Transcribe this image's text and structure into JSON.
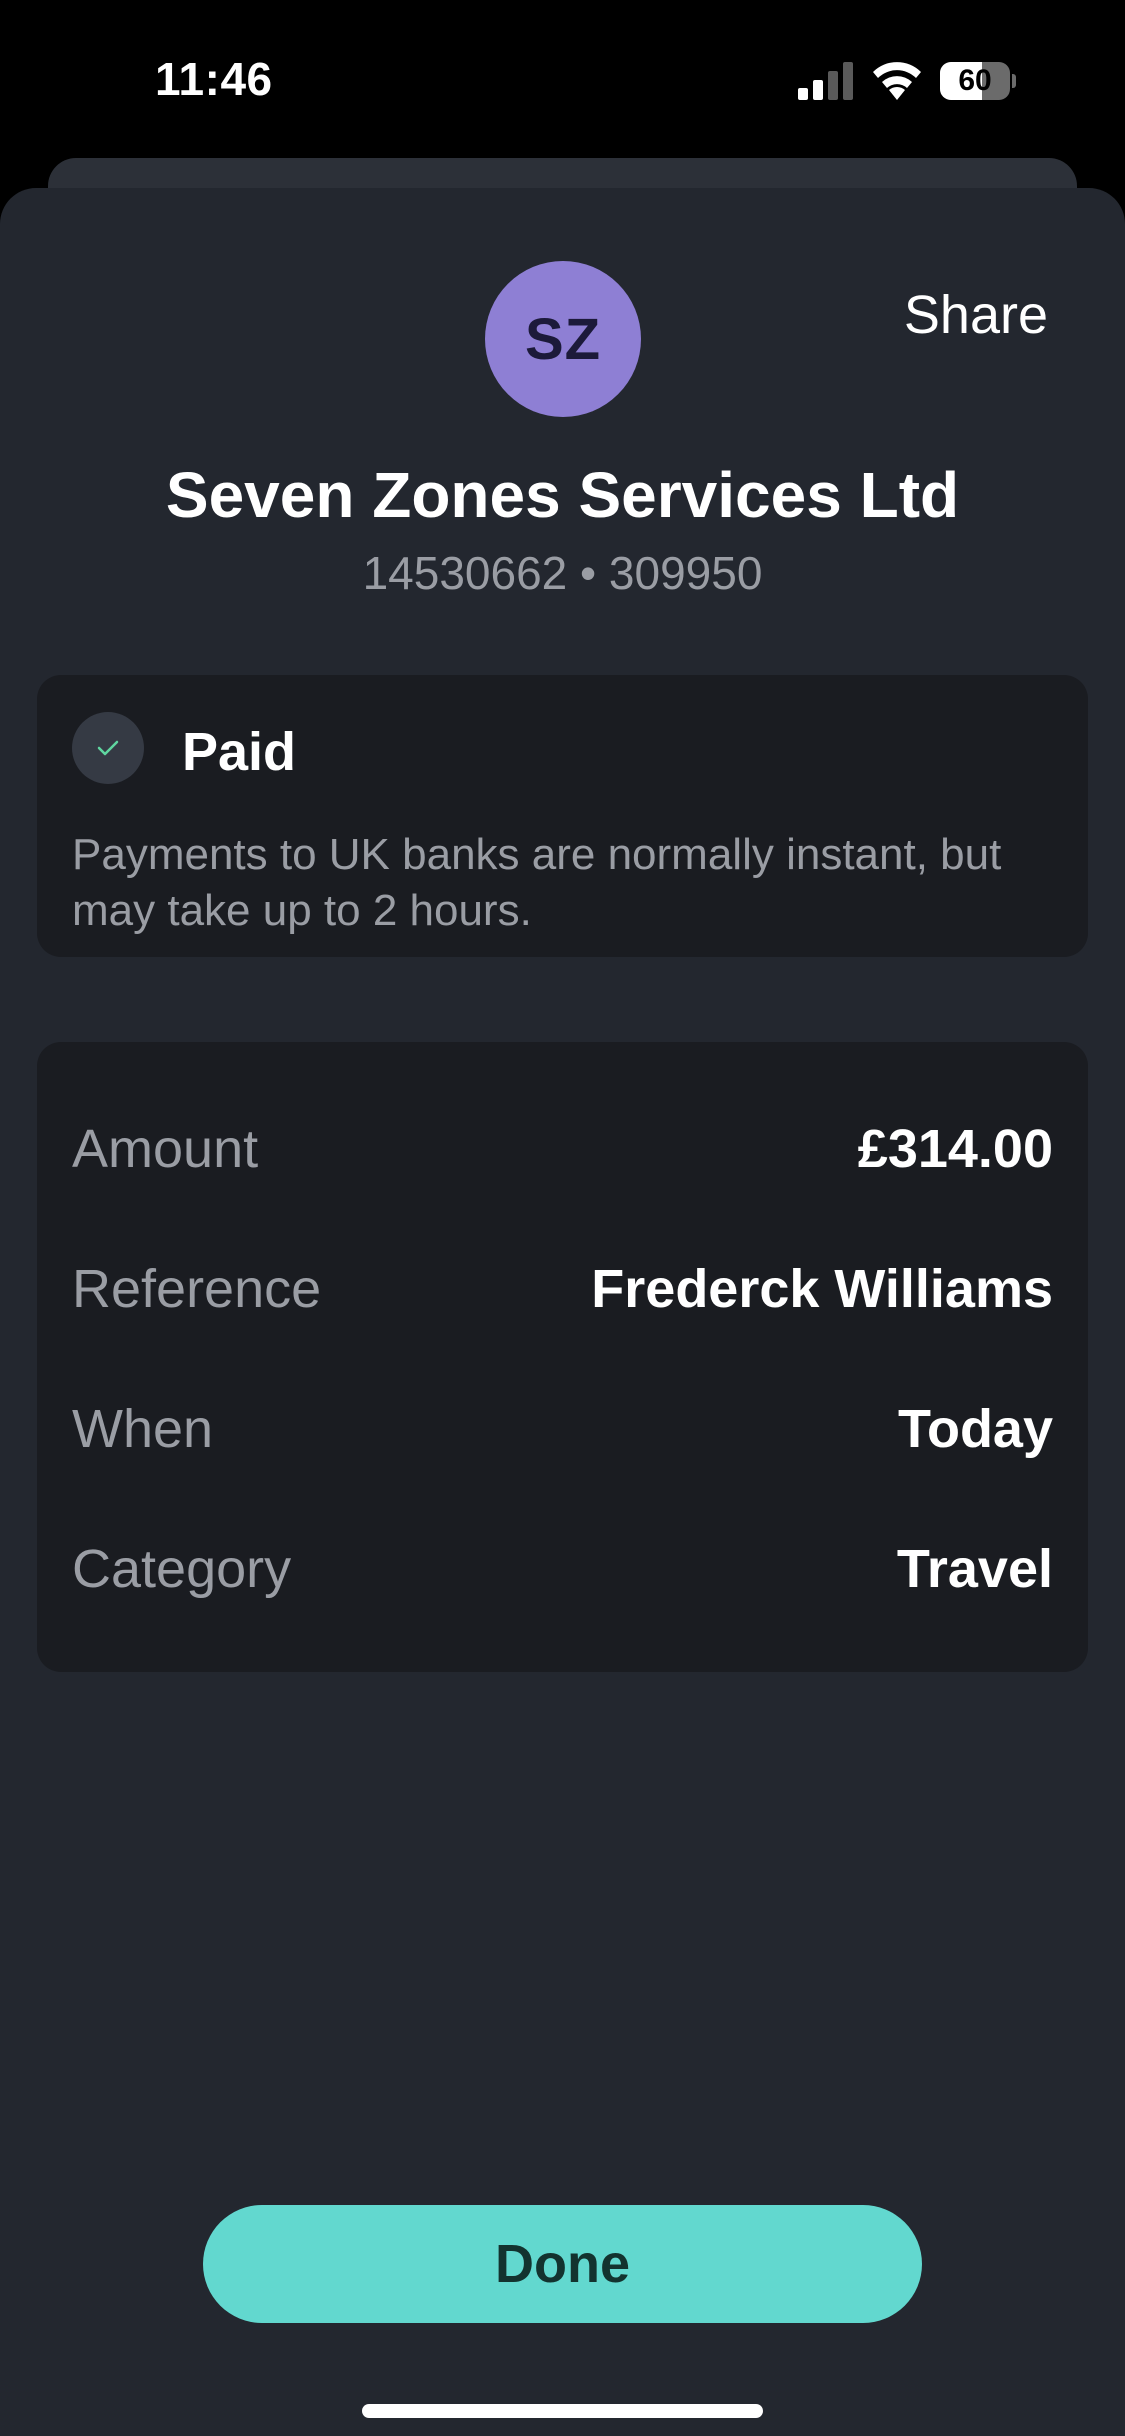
{
  "status_bar": {
    "time": "11:46",
    "battery_percent": "60",
    "battery_level": 0.6,
    "icons": [
      "signal-icon",
      "wifi-icon",
      "battery-icon"
    ]
  },
  "header": {
    "share_label": "Share",
    "avatar_initials": "SZ",
    "avatar_color": "#8e7fd4",
    "payee_name": "Seven Zones Services Ltd",
    "account_details": "14530662 • 309950"
  },
  "status_card": {
    "title": "Paid",
    "icon": "check-icon",
    "description": "Payments to UK banks are normally instant, but may take up to 2 hours."
  },
  "details": [
    {
      "label": "Amount",
      "value": "£314.00"
    },
    {
      "label": "Reference",
      "value": "Frederck Williams"
    },
    {
      "label": "When",
      "value": "Today"
    },
    {
      "label": "Category",
      "value": "Travel"
    }
  ],
  "footer": {
    "done_label": "Done",
    "accent_color": "#62d8cf"
  }
}
